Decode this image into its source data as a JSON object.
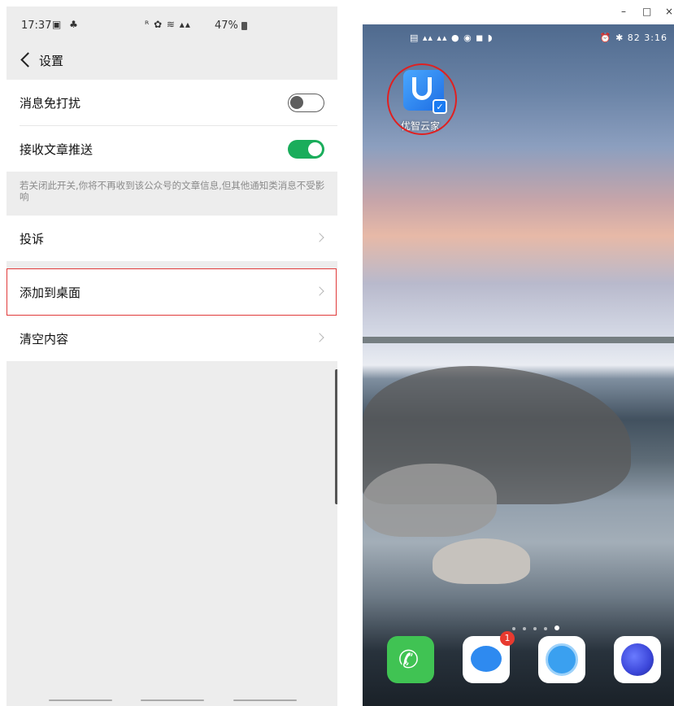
{
  "left": {
    "status": {
      "time": "17:37",
      "battery": "47%"
    },
    "nav": {
      "title": "设置"
    },
    "rows": {
      "dnd": "消息免打扰",
      "push": "接收文章推送",
      "note": "若关闭此开关,你将不再收到该公众号的文章信息,但其他通知类消息不受影响",
      "complain": "投诉",
      "add_desktop": "添加到桌面",
      "clear": "清空内容"
    },
    "toggles": {
      "dnd": "off",
      "push": "on"
    },
    "accent_colors": {
      "toggle_on": "#1aad5b",
      "highlight": "#e03a3a"
    }
  },
  "right": {
    "window_buttons": [
      "–",
      "□",
      "×"
    ],
    "phone_status": {
      "time": "3:16",
      "battery": "82"
    },
    "app": {
      "name": "优智云家"
    },
    "page_count": 5,
    "active_page": 5,
    "dock": {
      "messages_badge": "1"
    }
  }
}
